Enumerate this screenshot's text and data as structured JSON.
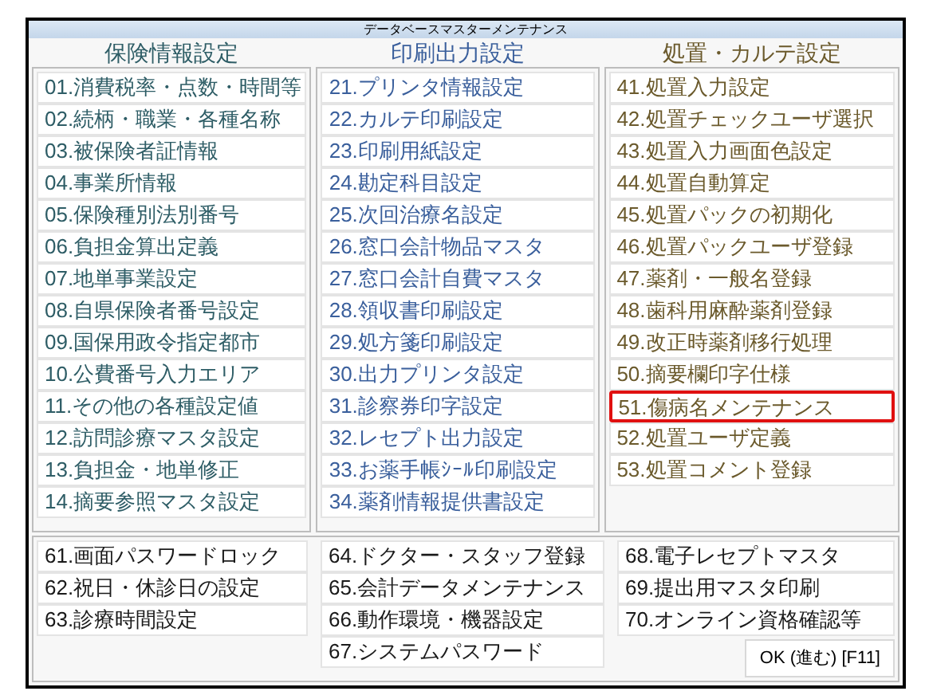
{
  "window": {
    "title": "データベースマスターメンテナンス"
  },
  "sections": [
    {
      "heading": "保険情報設定",
      "color": "#2e5d66",
      "items": [
        {
          "label": "01.消費税率・点数・時間等",
          "selected": false
        },
        {
          "label": "02.続柄・職業・各種名称",
          "selected": false
        },
        {
          "label": "03.被保険者証情報",
          "selected": false
        },
        {
          "label": "04.事業所情報",
          "selected": false
        },
        {
          "label": "05.保険種別法別番号",
          "selected": false
        },
        {
          "label": "06.負担金算出定義",
          "selected": false
        },
        {
          "label": "07.地単事業設定",
          "selected": false
        },
        {
          "label": "08.自県保険者番号設定",
          "selected": false
        },
        {
          "label": "09.国保用政令指定都市",
          "selected": false
        },
        {
          "label": "10.公費番号入力エリア",
          "selected": false
        },
        {
          "label": "11.その他の各種設定値",
          "selected": false
        },
        {
          "label": "12.訪問診療マスタ設定",
          "selected": false
        },
        {
          "label": "13.負担金・地単修正",
          "selected": false
        },
        {
          "label": "14.摘要参照マスタ設定",
          "selected": false
        }
      ]
    },
    {
      "heading": "印刷出力設定",
      "color": "#3a5f9c",
      "items": [
        {
          "label": "21.プリンタ情報設定",
          "selected": false
        },
        {
          "label": "22.カルテ印刷設定",
          "selected": false
        },
        {
          "label": "23.印刷用紙設定",
          "selected": false
        },
        {
          "label": "24.勘定科目設定",
          "selected": false
        },
        {
          "label": "25.次回治療名設定",
          "selected": false
        },
        {
          "label": "26.窓口会計物品マスタ",
          "selected": false
        },
        {
          "label": "27.窓口会計自費マスタ",
          "selected": false
        },
        {
          "label": "28.領収書印刷設定",
          "selected": false
        },
        {
          "label": "29.処方箋印刷設定",
          "selected": false
        },
        {
          "label": "30.出力プリンタ設定",
          "selected": false
        },
        {
          "label": "31.診察券印字設定",
          "selected": false
        },
        {
          "label": "32.レセプト出力設定",
          "selected": false
        },
        {
          "label": "33.お薬手帳ｼｰﾙ印刷設定",
          "selected": false
        },
        {
          "label": "34.薬剤情報提供書設定",
          "selected": false
        }
      ]
    },
    {
      "heading": "処置・カルテ設定",
      "color": "#6b5a2c",
      "items": [
        {
          "label": "41.処置入力設定",
          "selected": false
        },
        {
          "label": "42.処置チェックユーザ選択",
          "selected": false
        },
        {
          "label": "43.処置入力画面色設定",
          "selected": false
        },
        {
          "label": "44.処置自動算定",
          "selected": false
        },
        {
          "label": "45.処置パックの初期化",
          "selected": false
        },
        {
          "label": "46.処置パックユーザ登録",
          "selected": false
        },
        {
          "label": "47.薬剤・一般名登録",
          "selected": false
        },
        {
          "label": "48.歯科用麻酔薬剤登録",
          "selected": false
        },
        {
          "label": "49.改正時薬剤移行処理",
          "selected": false
        },
        {
          "label": "50.摘要欄印字仕様",
          "selected": false
        },
        {
          "label": "51.傷病名メンテナンス",
          "selected": true
        },
        {
          "label": "52.処置ユーザ定義",
          "selected": false
        },
        {
          "label": "53.処置コメント登録",
          "selected": false
        }
      ]
    }
  ],
  "bottom_columns": [
    [
      {
        "label": "61.画面パスワードロック",
        "selected": false
      },
      {
        "label": "62.祝日・休診日の設定",
        "selected": false
      },
      {
        "label": "63.診療時間設定",
        "selected": false
      }
    ],
    [
      {
        "label": "64.ドクター・スタッフ登録",
        "selected": false
      },
      {
        "label": "65.会計データメンテナンス",
        "selected": false
      },
      {
        "label": "66.動作環境・機器設定",
        "selected": false
      },
      {
        "label": "67.システムパスワード",
        "selected": false
      }
    ],
    [
      {
        "label": "68.電子レセプトマスタ",
        "selected": false
      },
      {
        "label": "69.提出用マスタ印刷",
        "selected": false
      },
      {
        "label": "70.オンライン資格確認等",
        "selected": false
      }
    ]
  ],
  "ok_button": "OK (進む) [F11]"
}
